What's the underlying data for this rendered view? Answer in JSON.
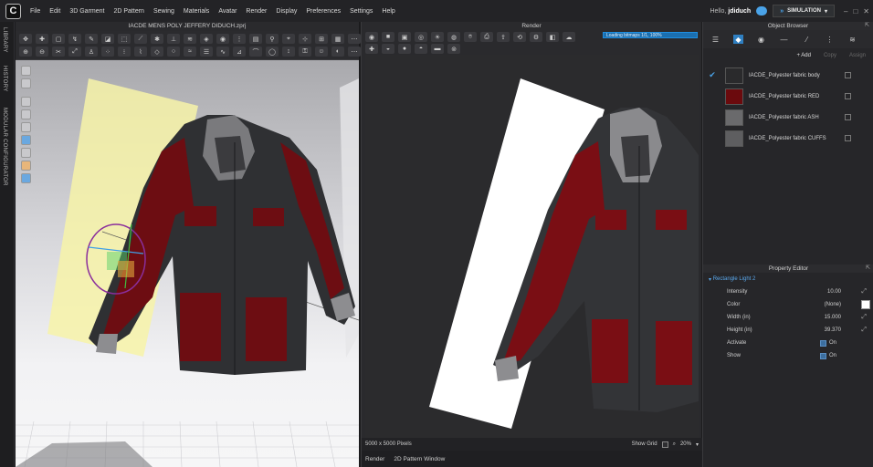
{
  "app": {
    "logo_letter": "C",
    "menus": [
      "File",
      "Edit",
      "3D Garment",
      "2D Pattern",
      "Sewing",
      "Materials",
      "Avatar",
      "Render",
      "Display",
      "Preferences",
      "Settings",
      "Help"
    ],
    "hello_prefix": "Hello, ",
    "username": "jdiduch",
    "mode_label": "SIMULATION"
  },
  "left_tabs": [
    "LIBRARY",
    "HISTORY",
    "MODULAR CONFIGURATOR"
  ],
  "garment_window": {
    "title": "IACDE MENS POLY JEFFERY DIDUCH.zprj"
  },
  "render_window": {
    "title": "Render",
    "loading": "Loading bitmaps 1/1, 100%",
    "pixels": "5000 x 5000 Pixels",
    "show_grid": "Show Grid",
    "zoom": "20%",
    "bottom_tabs": [
      "Render",
      "2D Pattern Window"
    ]
  },
  "object_browser": {
    "title": "Object Browser",
    "actions": {
      "add": "+ Add",
      "copy": "Copy",
      "assign": "Assign"
    },
    "fabrics": [
      {
        "name": "IACDE_Polyester fabric body",
        "color": "#2a2a2c",
        "selected": true
      },
      {
        "name": "IACDE_Polyester fabric RED",
        "color": "#6b0a0d",
        "selected": false
      },
      {
        "name": "IACDE_Polyester fabric ASH",
        "color": "#6a6a6c",
        "selected": false
      },
      {
        "name": "IACDE_Polyester fabric CUFFS",
        "color": "#5e5e60",
        "selected": false
      }
    ]
  },
  "property_editor": {
    "title": "Property Editor",
    "object": "Rectangle Light 2",
    "rows": {
      "intensity": {
        "label": "Intensity",
        "value": "10.00"
      },
      "color": {
        "label": "Color",
        "value": "(None)"
      },
      "width": {
        "label": "Width (in)",
        "value": "15.000"
      },
      "height": {
        "label": "Height (in)",
        "value": "39.370"
      },
      "activate": {
        "label": "Activate",
        "value": "On"
      },
      "show": {
        "label": "Show",
        "value": "On"
      }
    }
  }
}
